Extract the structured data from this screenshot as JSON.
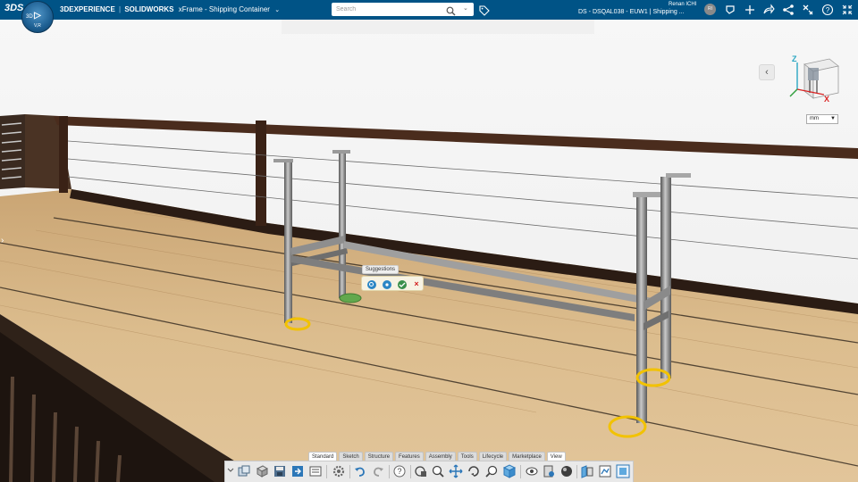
{
  "topbar": {
    "compass_top": "3D",
    "compass_left": "3D",
    "compass_bottom": "V,R",
    "ds_logo": "3DS",
    "brand_3d": "3DEXPERIENCE",
    "brand_sep": "|",
    "brand_solid": "SOLIDWORKS",
    "app_title": "xFrame - Shipping Container",
    "search_placeholder": "Search",
    "context": "DS - DSQAL038 - EUW1 | Shipping ...",
    "user_name": "Renan ICHI",
    "avatar_initials": "RI"
  },
  "viewport": {
    "collapse_label": "‹",
    "side_arrow": "›",
    "units": "mm",
    "axis_z": "Z",
    "axis_x": "X"
  },
  "suggestions": {
    "label": "Suggestions",
    "close": "×"
  },
  "command_tabs": [
    {
      "label": "Standard"
    },
    {
      "label": "Sketch"
    },
    {
      "label": "Structure"
    },
    {
      "label": "Features"
    },
    {
      "label": "Assembly"
    },
    {
      "label": "Tools"
    },
    {
      "label": "Lifecycle"
    },
    {
      "label": "Marketplace"
    },
    {
      "label": "View"
    }
  ],
  "colors": {
    "topbar_bg": "#005386",
    "sky": "#f4f4f4",
    "deck": "#d8b787",
    "railing": "#3b2417",
    "highlight_ring": "#f2c200",
    "selected_foot": "#62a84d"
  }
}
